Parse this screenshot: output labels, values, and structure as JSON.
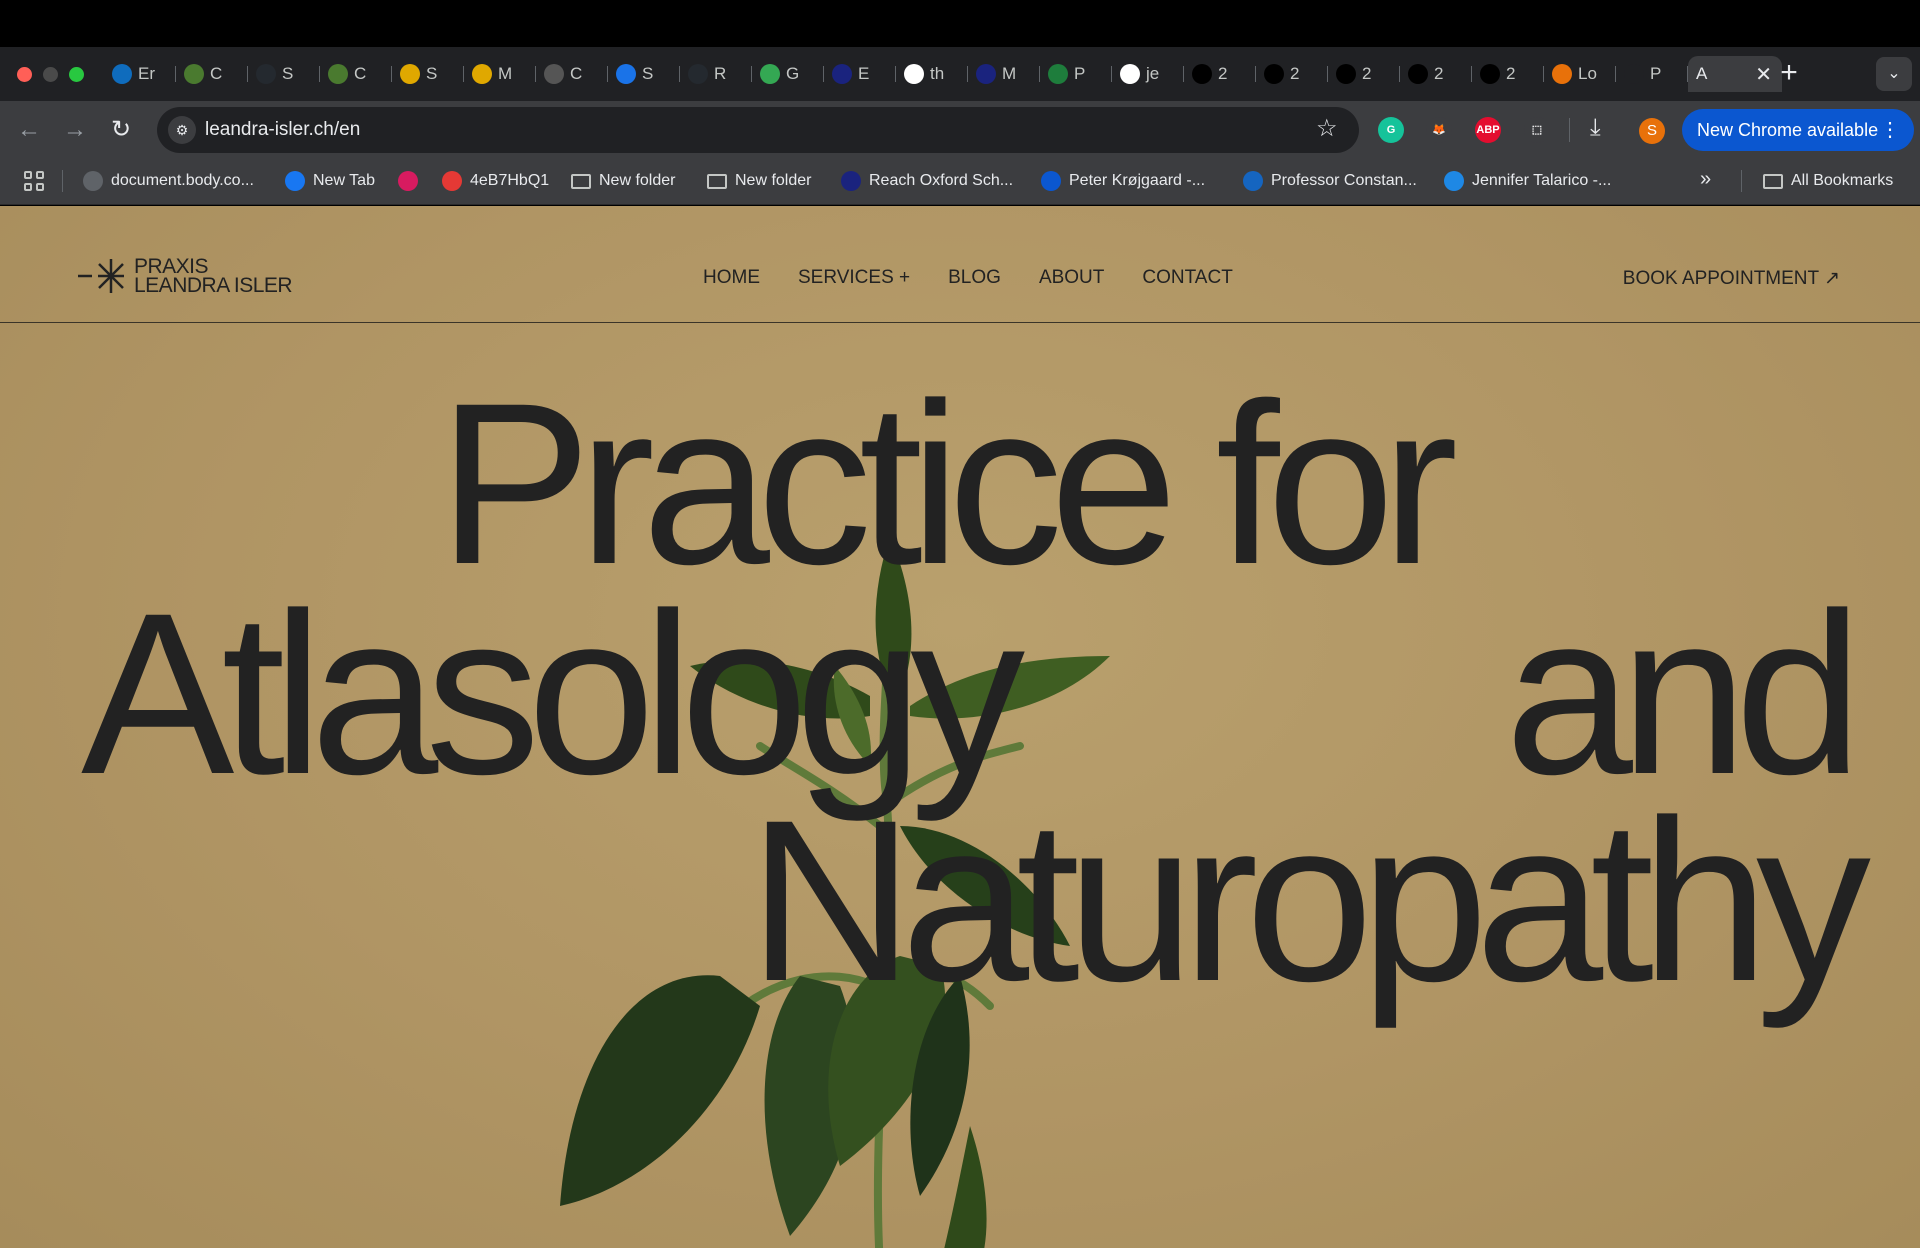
{
  "browser": {
    "tabs": [
      {
        "label": "Er",
        "icon": "outlook-icon",
        "color": "#0f6cbd"
      },
      {
        "label": "C",
        "icon": "leaf-icon",
        "color": "#4a7a2f"
      },
      {
        "label": "S",
        "icon": "github-icon",
        "color": "#24292f"
      },
      {
        "label": "C",
        "icon": "leaf-icon",
        "color": "#4a7a2f"
      },
      {
        "label": "S",
        "icon": "emoji-icon",
        "color": "#e0a800"
      },
      {
        "label": "M",
        "icon": "emoji-icon",
        "color": "#e0a800"
      },
      {
        "label": "C",
        "icon": "openai-icon",
        "color": "#555555"
      },
      {
        "label": "S",
        "icon": "image-icon",
        "color": "#1a73e8"
      },
      {
        "label": "R",
        "icon": "github-icon",
        "color": "#24292f"
      },
      {
        "label": "G",
        "icon": "drive-icon",
        "color": "#34a853"
      },
      {
        "label": "E",
        "icon": "globe-icon",
        "color": "#1a237e"
      },
      {
        "label": "th",
        "icon": "circle-icon",
        "color": "#ffffff"
      },
      {
        "label": "M",
        "icon": "globe-icon",
        "color": "#1a237e"
      },
      {
        "label": "P",
        "icon": "vuejs-icon",
        "color": "#1e7d3c"
      },
      {
        "label": "je",
        "icon": "google-icon",
        "color": "#ffffff"
      },
      {
        "label": "2",
        "icon": "dot-icon",
        "color": "#000000"
      },
      {
        "label": "2",
        "icon": "dot-icon",
        "color": "#000000"
      },
      {
        "label": "2",
        "icon": "dot-icon",
        "color": "#000000"
      },
      {
        "label": "2",
        "icon": "dot-icon",
        "color": "#000000"
      },
      {
        "label": "2",
        "icon": "dot-icon",
        "color": "#000000"
      },
      {
        "label": "Lo",
        "icon": "heart-icon",
        "color": "#e8710a"
      },
      {
        "label": "P",
        "icon": "w-icon",
        "color": "#202124"
      }
    ],
    "active_tab": {
      "label": "A"
    },
    "url": "leandra-isler.ch/en",
    "update_button": "New Chrome available",
    "profile_initial": "S",
    "extensions": [
      {
        "name": "grammarly-icon",
        "label": "G",
        "color": "#15c39a"
      },
      {
        "name": "metamask-icon",
        "label": "🦊",
        "color": "#3c3d40"
      },
      {
        "name": "adblock-icon",
        "label": "ABP",
        "color": "#e40d2f"
      },
      {
        "name": "puzzle-icon",
        "label": "⬚",
        "color": "#3c3d40"
      }
    ],
    "bookmarks": [
      {
        "label": "document.body.co...",
        "icon": "globe-icon",
        "color": "#5f6368"
      },
      {
        "label": "New Tab",
        "icon": "facebook-icon",
        "color": "#1877f2"
      },
      {
        "label": "",
        "icon": "s-logo-icon",
        "color": "#d81b60"
      },
      {
        "label": "4eB7HbQ1",
        "icon": "record-icon",
        "color": "#e53935"
      },
      {
        "label": "New folder",
        "icon": "folder-icon",
        "color": ""
      },
      {
        "label": "New folder",
        "icon": "folder-icon",
        "color": ""
      },
      {
        "label": "Reach Oxford Sch...",
        "icon": "shield-icon",
        "color": "#1a237e"
      },
      {
        "label": "Peter Krøjgaard -...",
        "icon": "chart-wave-icon",
        "color": "#0b57d0"
      },
      {
        "label": "Professor Constan...",
        "icon": "s-letter-icon",
        "color": "#1565c0"
      },
      {
        "label": "Jennifer Talarico -...",
        "icon": "earth-icon",
        "color": "#1e88e5"
      }
    ],
    "all_bookmarks": "All Bookmarks"
  },
  "site": {
    "logo_line1": "PRAXIS",
    "logo_line2": "LEANDRA ISLER",
    "nav": [
      "HOME",
      "SERVICES +",
      "BLOG",
      "ABOUT",
      "CONTACT"
    ],
    "book": "BOOK APPOINTMENT ↗",
    "hero": {
      "line1": "Practice for",
      "line2a": "Atlasology",
      "line2b": "and",
      "line3": "Naturopathy"
    },
    "bg_color": "#b09564",
    "text_color": "#222222"
  }
}
